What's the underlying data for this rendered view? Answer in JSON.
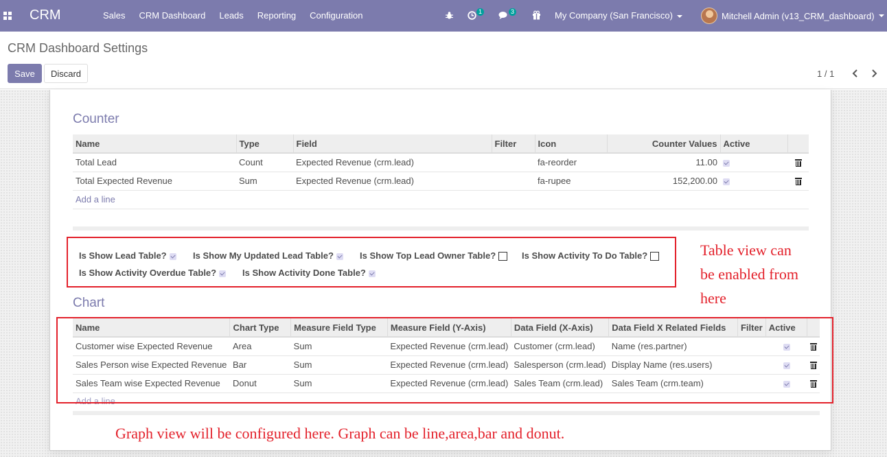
{
  "navbar": {
    "brand": "CRM",
    "menu": [
      "Sales",
      "CRM Dashboard",
      "Leads",
      "Reporting",
      "Configuration"
    ],
    "activity_badge": "1",
    "messages_badge": "3",
    "company": "My Company (San Francisco)",
    "user": "Mitchell Admin (v13_CRM_dashboard)",
    "accent": "#7c7bad"
  },
  "control_panel": {
    "title": "CRM Dashboard Settings",
    "save_label": "Save",
    "discard_label": "Discard",
    "pager": "1 / 1"
  },
  "counter": {
    "title": "Counter",
    "columns": [
      "Name",
      "Type",
      "Field",
      "Filter",
      "Icon",
      "Counter Values",
      "Active"
    ],
    "rows": [
      {
        "name": "Total Lead",
        "type": "Count",
        "field": "Expected Revenue (crm.lead)",
        "filter": "",
        "icon": "fa-reorder",
        "value": "11.00",
        "active": true
      },
      {
        "name": "Total Expected Revenue",
        "type": "Sum",
        "field": "Expected Revenue (crm.lead)",
        "filter": "",
        "icon": "fa-rupee",
        "value": "152,200.00",
        "active": true
      }
    ],
    "add_line": "Add a line"
  },
  "table_flags": {
    "lead_table": "Is Show Lead Table?",
    "updated_lead_table": "Is Show My Updated Lead Table?",
    "top_owner_table": "Is Show Top Lead Owner Table?",
    "activity_todo_table": "Is Show Activity To Do Table?",
    "activity_overdue_table": "Is Show Activity Overdue Table?",
    "activity_done_table": "Is Show Activity Done Table?",
    "values": {
      "lead_table": true,
      "updated_lead_table": true,
      "top_owner_table": false,
      "activity_todo_table": false,
      "activity_overdue_table": true,
      "activity_done_table": true
    }
  },
  "chart": {
    "title": "Chart",
    "columns": [
      "Name",
      "Chart Type",
      "Measure Field Type",
      "Measure Field (Y-Axis)",
      "Data Field (X-Axis)",
      "Data Field X Related Fields",
      "Filter",
      "Active"
    ],
    "rows": [
      {
        "name": "Customer wise Expected Revenue",
        "chart_type": "Area",
        "measure_type": "Sum",
        "measure_field": "Expected Revenue (crm.lead)",
        "data_field": "Customer (crm.lead)",
        "related": "Name (res.partner)",
        "filter": "",
        "active": true
      },
      {
        "name": "Sales Person wise Expected Revenue",
        "chart_type": "Bar",
        "measure_type": "Sum",
        "measure_field": "Expected Revenue (crm.lead)",
        "data_field": "Salesperson (crm.lead)",
        "related": "Display Name (res.users)",
        "filter": "",
        "active": true
      },
      {
        "name": "Sales Team wise Expected Revenue",
        "chart_type": "Donut",
        "measure_type": "Sum",
        "measure_field": "Expected Revenue (crm.lead)",
        "data_field": "Sales Team (crm.lead)",
        "related": "Sales Team (crm.team)",
        "filter": "",
        "active": true
      }
    ],
    "add_line": "Add a line"
  },
  "annotations": {
    "table_note_lines": [
      "Table view can",
      "be enabled from",
      "here"
    ],
    "graph_note": "Graph view will be configured here. Graph can be line,area,bar and donut.",
    "color": "#e3202a"
  }
}
